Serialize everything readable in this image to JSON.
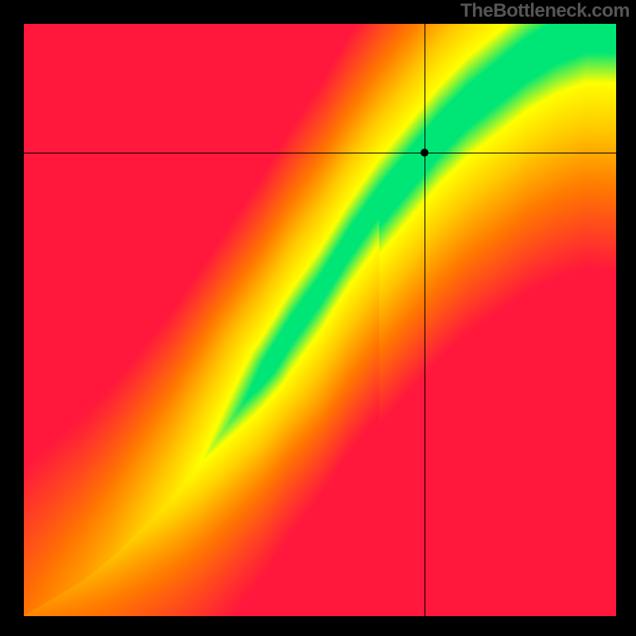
{
  "attribution": "TheBottleneck.com",
  "chart_data": {
    "type": "heatmap",
    "title": "",
    "xlabel": "",
    "ylabel": "",
    "xlim": [
      0,
      1
    ],
    "ylim": [
      0,
      1
    ],
    "marker": {
      "x": 0.676,
      "y": 0.782
    },
    "crosshair": {
      "x": 0.676,
      "y": 0.782
    },
    "optimal_curve": [
      {
        "x": 0.0,
        "y": 0.0
      },
      {
        "x": 0.05,
        "y": 0.03
      },
      {
        "x": 0.1,
        "y": 0.06
      },
      {
        "x": 0.15,
        "y": 0.1
      },
      {
        "x": 0.2,
        "y": 0.15
      },
      {
        "x": 0.25,
        "y": 0.2
      },
      {
        "x": 0.3,
        "y": 0.26
      },
      {
        "x": 0.35,
        "y": 0.33
      },
      {
        "x": 0.4,
        "y": 0.4
      },
      {
        "x": 0.45,
        "y": 0.48
      },
      {
        "x": 0.5,
        "y": 0.55
      },
      {
        "x": 0.55,
        "y": 0.63
      },
      {
        "x": 0.6,
        "y": 0.7
      },
      {
        "x": 0.65,
        "y": 0.76
      },
      {
        "x": 0.7,
        "y": 0.82
      },
      {
        "x": 0.75,
        "y": 0.87
      },
      {
        "x": 0.8,
        "y": 0.91
      },
      {
        "x": 0.85,
        "y": 0.95
      },
      {
        "x": 0.9,
        "y": 0.98
      },
      {
        "x": 0.95,
        "y": 1.0
      }
    ],
    "color_scale": [
      "#ff0033",
      "#ff6600",
      "#ffcc00",
      "#ffff00",
      "#00e676"
    ],
    "description": "Heatmap showing bottleneck severity. Green diagonal band indicates balanced configuration; red regions indicate severe bottleneck. Black crosshair marks a specific configuration point."
  }
}
